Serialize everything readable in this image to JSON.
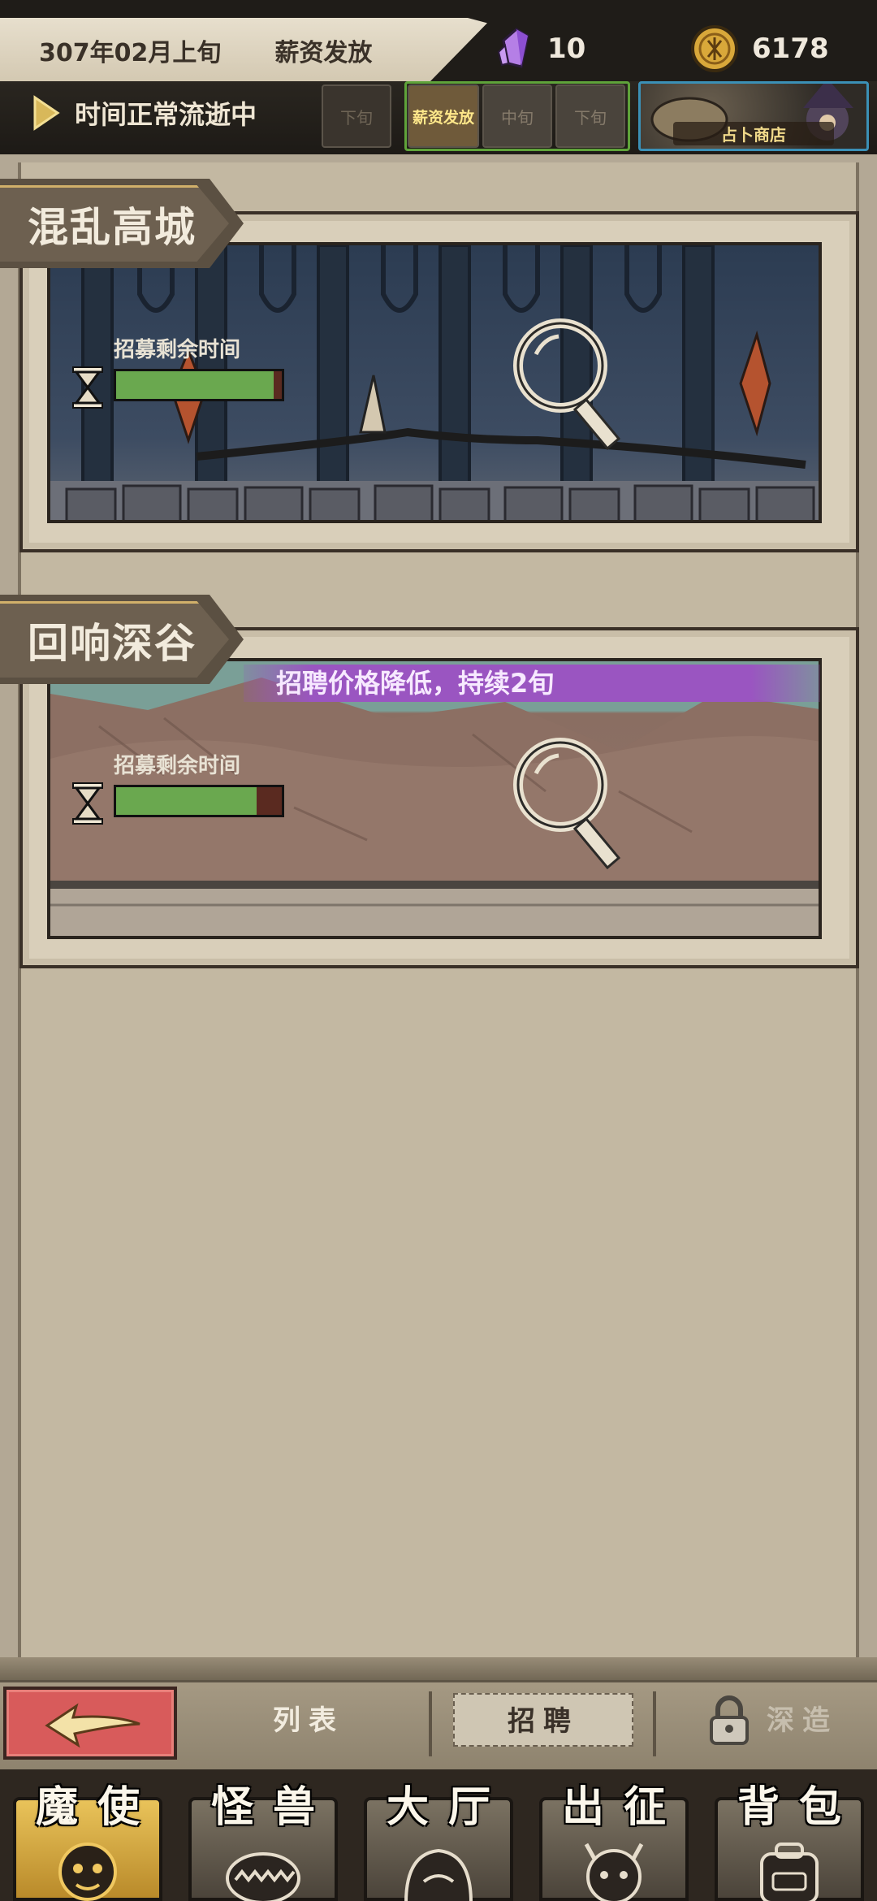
{
  "header": {
    "date": "307年02月上旬",
    "event": "薪资发放",
    "crystal_count": "10",
    "gold_count": "6178"
  },
  "time": {
    "status": "时间正常流逝中",
    "periods": [
      "下旬",
      "薪资发放",
      "中旬",
      "下旬"
    ],
    "shop_label": "占卜商店"
  },
  "areas": [
    {
      "name": "混乱高城",
      "timer_label": "招募剩余时间",
      "remaining_fraction": 0.95,
      "buff": ""
    },
    {
      "name": "回响深谷",
      "timer_label": "招募剩余时间",
      "remaining_fraction": 0.85,
      "buff": "招聘价格降低，持续2旬"
    }
  ],
  "subnav": {
    "list": "列表",
    "recruit": "招聘",
    "forge": "深造"
  },
  "mainnav": [
    {
      "label": "魔使",
      "icon": "envoy-icon"
    },
    {
      "label": "怪兽",
      "icon": "monster-icon"
    },
    {
      "label": "大厅",
      "icon": "hall-icon"
    },
    {
      "label": "出征",
      "icon": "expedition-icon"
    },
    {
      "label": "背包",
      "icon": "backpack-icon"
    }
  ],
  "colors": {
    "progress": "#6aa84f",
    "buff": "#9a55c1",
    "back_button": "#d85b5b"
  }
}
